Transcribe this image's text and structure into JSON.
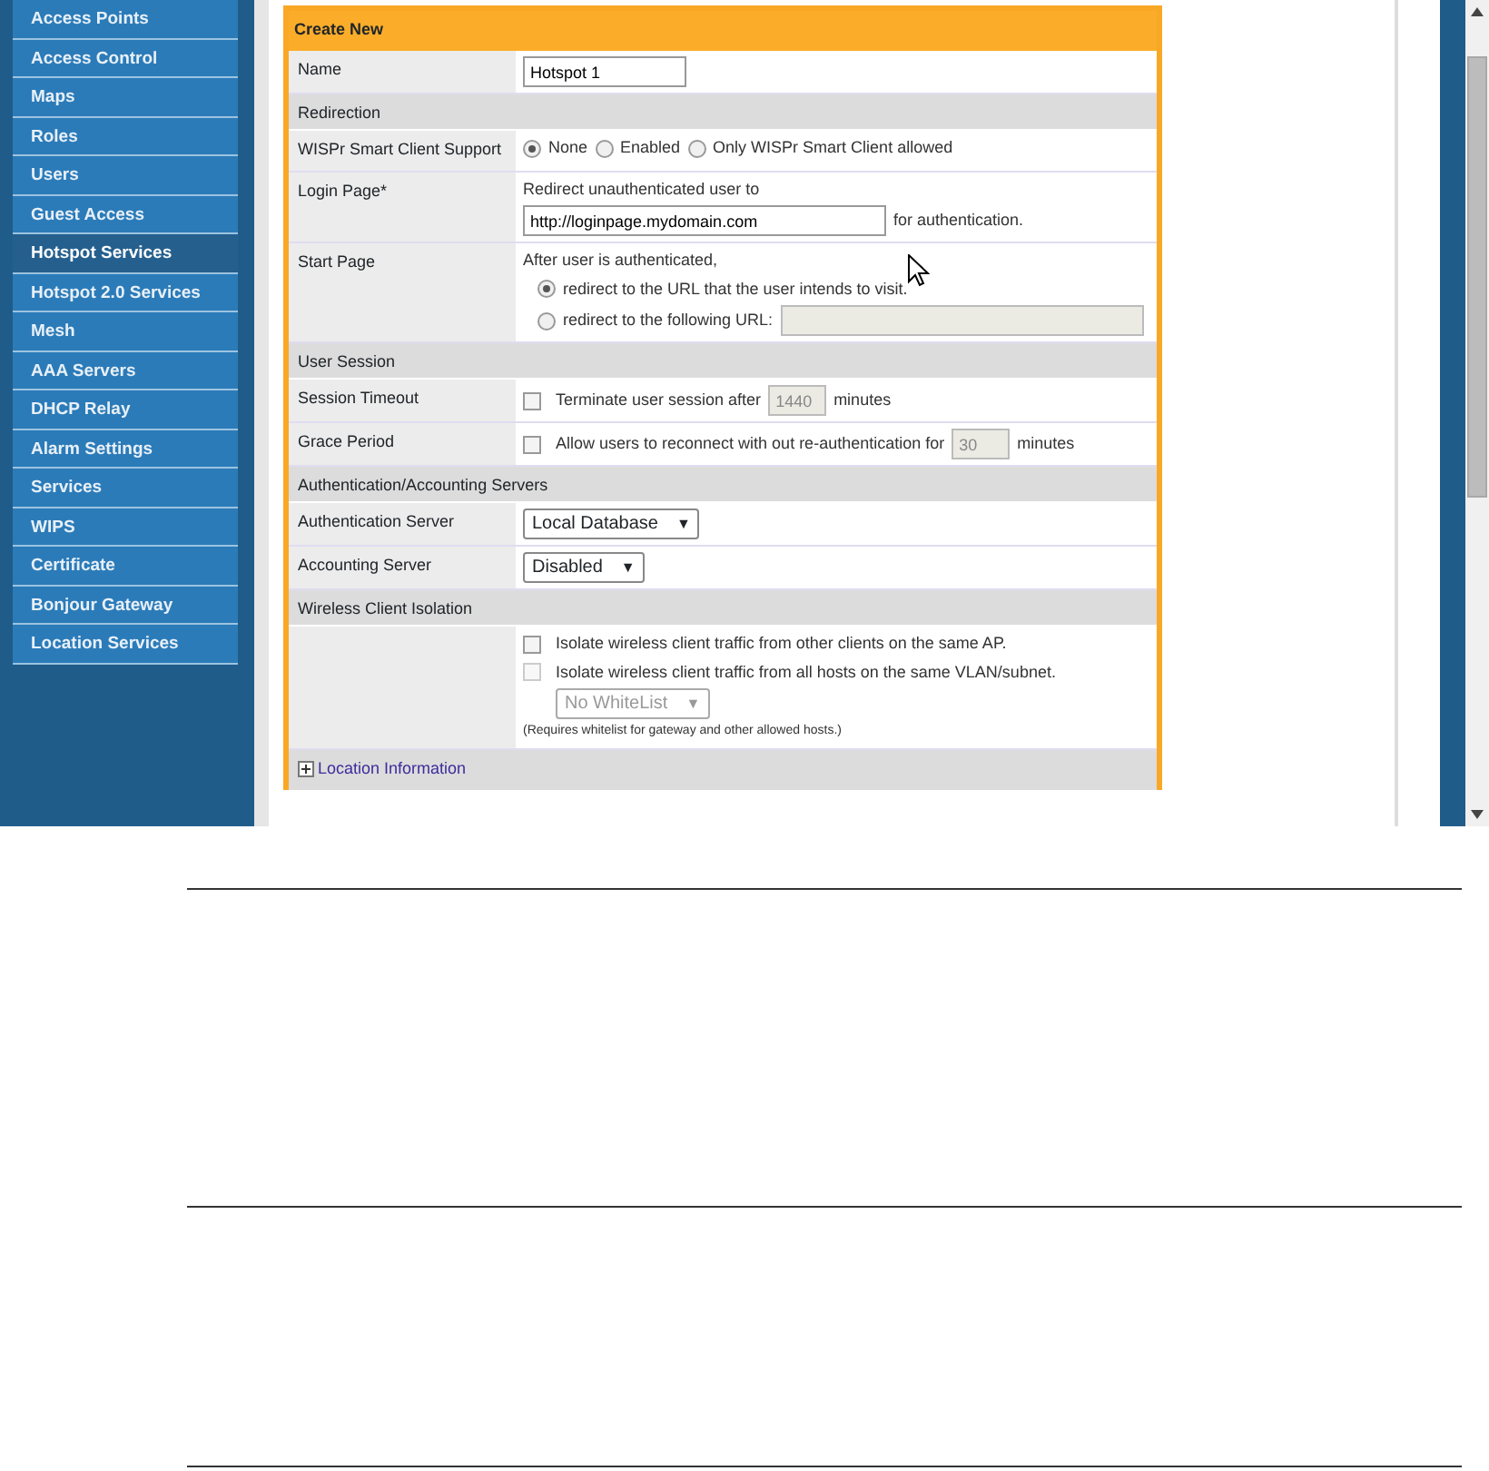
{
  "sidebar": {
    "items": [
      {
        "label": "Access Points",
        "selected": false
      },
      {
        "label": "Access Control",
        "selected": false
      },
      {
        "label": "Maps",
        "selected": false
      },
      {
        "label": "Roles",
        "selected": false
      },
      {
        "label": "Users",
        "selected": false
      },
      {
        "label": "Guest Access",
        "selected": false
      },
      {
        "label": "Hotspot Services",
        "selected": true
      },
      {
        "label": "Hotspot 2.0 Services",
        "selected": false
      },
      {
        "label": "Mesh",
        "selected": false
      },
      {
        "label": "AAA Servers",
        "selected": false
      },
      {
        "label": "DHCP Relay",
        "selected": false
      },
      {
        "label": "Alarm Settings",
        "selected": false
      },
      {
        "label": "Services",
        "selected": false
      },
      {
        "label": "WIPS",
        "selected": false
      },
      {
        "label": "Certificate",
        "selected": false
      },
      {
        "label": "Bonjour Gateway",
        "selected": false
      },
      {
        "label": "Location Services",
        "selected": false
      }
    ]
  },
  "form": {
    "title": "Create New",
    "rows": [
      {
        "kind": "field",
        "label": "Name",
        "lines": [
          [
            {
              "kind": "input",
              "value": "Hotspot 1",
              "disabled": false
            }
          ]
        ]
      },
      {
        "kind": "section",
        "label": "Redirection"
      },
      {
        "kind": "field",
        "label": "WISPr Smart Client Support",
        "lines": [
          [
            {
              "kind": "radio",
              "label": "None",
              "selected": true
            },
            {
              "kind": "radio",
              "label": "Enabled",
              "selected": false
            },
            {
              "kind": "radio",
              "label": "Only WISPr Smart Client allowed",
              "selected": false
            }
          ]
        ]
      },
      {
        "kind": "field",
        "label": "Login Page*",
        "lines": [
          [
            {
              "kind": "text",
              "text": "Redirect unauthenticated user to"
            }
          ],
          [
            {
              "kind": "wide_input",
              "value": "http://loginpage.mydomain.com",
              "disabled": false
            },
            {
              "kind": "text",
              "text": "for authentication."
            }
          ]
        ]
      },
      {
        "kind": "field",
        "label": "Start Page",
        "lines": [
          [
            {
              "kind": "text",
              "text": "After user is authenticated,"
            }
          ],
          [
            {
              "kind": "radio",
              "label": "redirect to the URL that the user intends to visit.",
              "selected": true
            }
          ],
          [
            {
              "kind": "radio",
              "label": "redirect to the following URL:",
              "selected": false
            },
            {
              "kind": "wide_input",
              "disabled": true
            }
          ]
        ]
      },
      {
        "kind": "section",
        "label": "User Session"
      },
      {
        "kind": "field",
        "label": "Session Timeout",
        "lines": [
          [
            {
              "kind": "checkbox",
              "label": "Terminate user session after",
              "checked": false,
              "disabled": false
            },
            {
              "kind": "number_input",
              "value": "1440",
              "disabled": true
            },
            {
              "kind": "text",
              "text": "minutes"
            }
          ]
        ]
      },
      {
        "kind": "field",
        "label": "Grace Period",
        "lines": [
          [
            {
              "kind": "checkbox",
              "label": "Allow users to reconnect with out re-authentication for",
              "checked": false,
              "disabled": false
            },
            {
              "kind": "number_input",
              "value": "30",
              "disabled": true
            },
            {
              "kind": "text",
              "text": "minutes"
            }
          ]
        ]
      },
      {
        "kind": "section",
        "label": "Authentication/Accounting Servers"
      },
      {
        "kind": "field",
        "label": "Authentication Server",
        "lines": [
          [
            {
              "kind": "select",
              "value": "Local Database",
              "caret": "▼",
              "disabled": false
            }
          ]
        ]
      },
      {
        "kind": "field",
        "label": "Accounting Server",
        "lines": [
          [
            {
              "kind": "select",
              "value": "Disabled",
              "caret": "▼",
              "disabled": false
            }
          ]
        ]
      },
      {
        "kind": "section",
        "label": "Wireless Client Isolation"
      },
      {
        "kind": "field",
        "label": "",
        "lines": [
          [
            {
              "kind": "checkbox",
              "label": "Isolate wireless client traffic from other clients on the same AP.",
              "checked": false,
              "disabled": false
            }
          ],
          [
            {
              "kind": "checkbox",
              "label": "Isolate wireless client traffic from all hosts on the same VLAN/subnet.",
              "checked": false,
              "disabled": true
            }
          ],
          [
            {
              "kind": "select",
              "value": "No WhiteList",
              "caret": "▼",
              "disabled": true
            }
          ],
          [
            {
              "kind": "note",
              "text": "(Requires whitelist for gateway and other allowed hosts.)"
            }
          ]
        ]
      },
      {
        "kind": "collapsible",
        "label": "Location Information",
        "expanded": false
      }
    ]
  }
}
